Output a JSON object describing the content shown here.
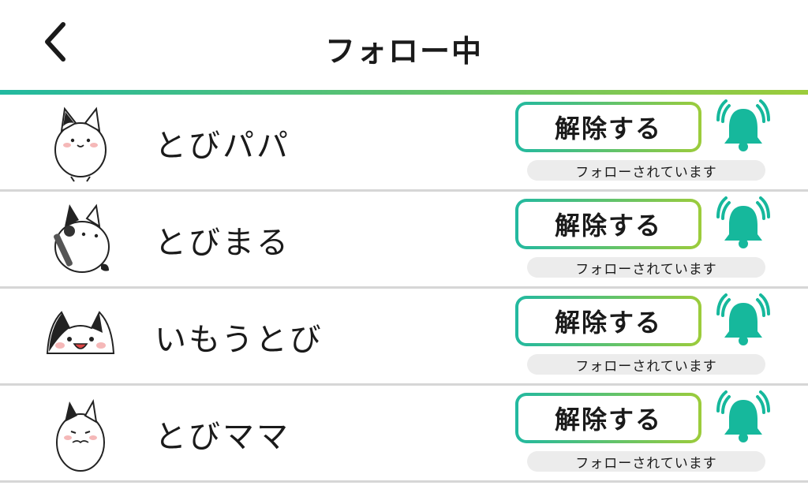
{
  "header": {
    "title": "フォロー中",
    "back_icon": "chevron-left-icon"
  },
  "colors": {
    "gradient_start": "#22b9a0",
    "gradient_end": "#9ccc3b",
    "bell": "#16b89c",
    "divider": "#d6d6d6",
    "pill_bg": "#ececec"
  },
  "follows": [
    {
      "name": "とびパパ",
      "action_label": "解除する",
      "status": "フォローされています",
      "avatar_icon": "cat-sitting-avatar",
      "bell_icon": "bell-ringing-icon"
    },
    {
      "name": "とびまる",
      "action_label": "解除する",
      "status": "フォローされています",
      "avatar_icon": "cat-microphone-avatar",
      "bell_icon": "bell-ringing-icon"
    },
    {
      "name": "いもうとび",
      "action_label": "解除する",
      "status": "フォローされています",
      "avatar_icon": "cat-face-avatar",
      "bell_icon": "bell-ringing-icon"
    },
    {
      "name": "とびママ",
      "action_label": "解除する",
      "status": "フォローされています",
      "avatar_icon": "cat-shy-avatar",
      "bell_icon": "bell-ringing-icon"
    }
  ]
}
